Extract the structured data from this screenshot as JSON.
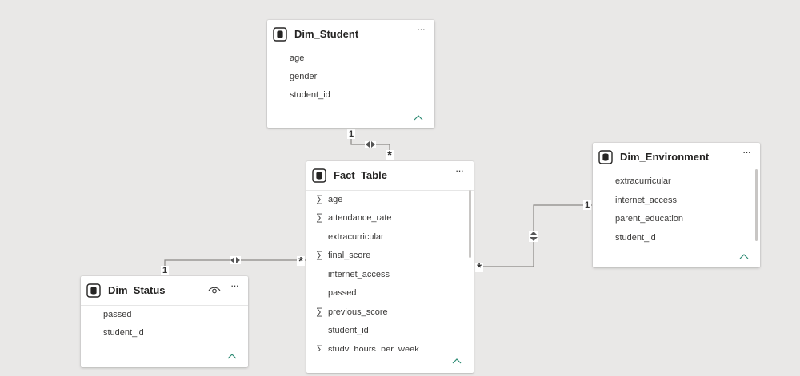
{
  "tables": {
    "dim_student": {
      "title": "Dim_Student",
      "fields": [
        {
          "name": "age",
          "sigma": ""
        },
        {
          "name": "gender",
          "sigma": ""
        },
        {
          "name": "student_id",
          "sigma": ""
        }
      ]
    },
    "fact_table": {
      "title": "Fact_Table",
      "fields": [
        {
          "name": "age",
          "sigma": "∑"
        },
        {
          "name": "attendance_rate",
          "sigma": "∑"
        },
        {
          "name": "extracurricular",
          "sigma": ""
        },
        {
          "name": "final_score",
          "sigma": "∑"
        },
        {
          "name": "internet_access",
          "sigma": ""
        },
        {
          "name": "passed",
          "sigma": ""
        },
        {
          "name": "previous_score",
          "sigma": "∑"
        },
        {
          "name": "student_id",
          "sigma": ""
        },
        {
          "name": "study_hours_per_week",
          "sigma": "∑"
        }
      ]
    },
    "dim_environment": {
      "title": "Dim_Environment",
      "fields": [
        {
          "name": "extracurricular",
          "sigma": ""
        },
        {
          "name": "internet_access",
          "sigma": ""
        },
        {
          "name": "parent_education",
          "sigma": ""
        },
        {
          "name": "student_id",
          "sigma": ""
        }
      ]
    },
    "dim_status": {
      "title": "Dim_Status",
      "fields": [
        {
          "name": "passed",
          "sigma": ""
        },
        {
          "name": "student_id",
          "sigma": ""
        }
      ]
    }
  },
  "relationships": {
    "student_one": "1",
    "student_many": "*",
    "environment_one": "1",
    "environment_many": "*",
    "status_one": "1",
    "status_many": "*"
  },
  "icons": {
    "more": "···",
    "table": "table-icon",
    "collapse": "chevron-up-icon",
    "visibility": "eye-icon",
    "bidirectional": "bidirectional-filter-icon"
  },
  "colors": {
    "canvas": "#e9e8e7",
    "card": "#ffffff",
    "line": "#8a8886",
    "chevron": "#2e8b74"
  }
}
